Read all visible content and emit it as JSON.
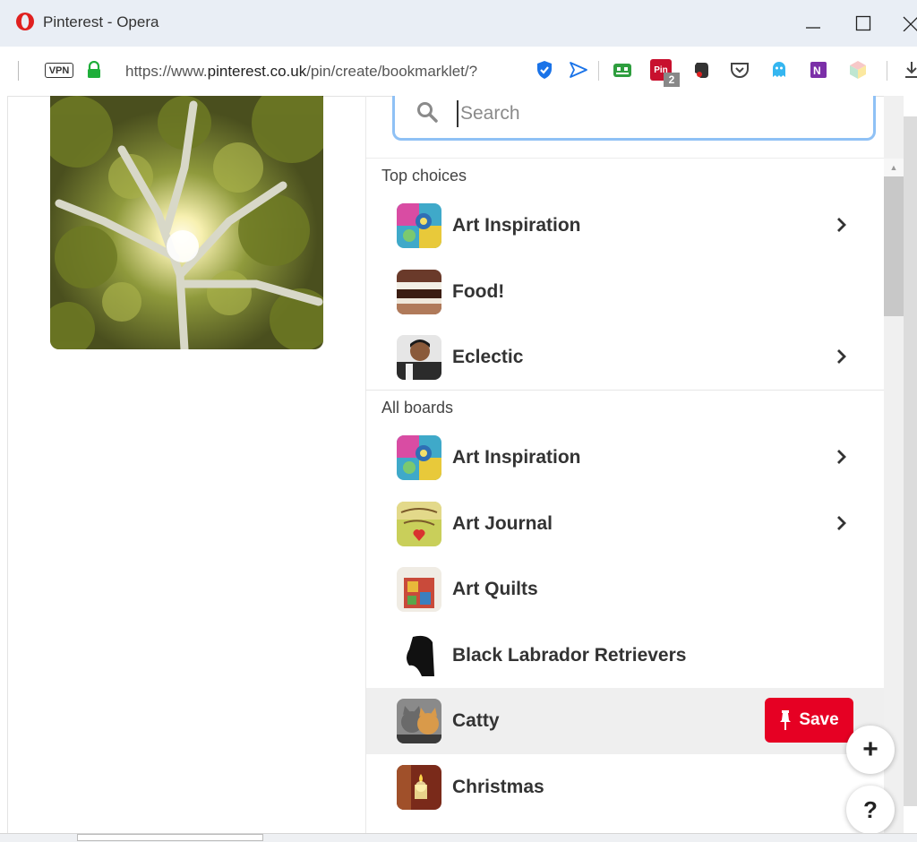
{
  "browser": {
    "title": "Pinterest - Opera",
    "vpn_label": "VPN",
    "url_prefix": "https://www.",
    "url_host": "pinterest.co.uk",
    "url_path": "/pin/create/bookmarklet/?",
    "extension_badge": "2",
    "extension_pin_label": "Pin",
    "window_buttons": {
      "minimize": "—",
      "maximize": "☐",
      "close": "✕"
    }
  },
  "search": {
    "placeholder": "Search",
    "value": ""
  },
  "sections": {
    "top_label": "Top choices",
    "all_label": "All boards"
  },
  "top_choices": [
    {
      "label": "Art Inspiration",
      "has_submenu": true
    },
    {
      "label": "Food!",
      "has_submenu": false
    },
    {
      "label": "Eclectic",
      "has_submenu": true
    }
  ],
  "all_boards": [
    {
      "label": "Art Inspiration",
      "has_submenu": true
    },
    {
      "label": "Art Journal",
      "has_submenu": true
    },
    {
      "label": "Art Quilts",
      "has_submenu": false
    },
    {
      "label": "Black Labrador Retrievers",
      "has_submenu": false
    },
    {
      "label": "Catty",
      "has_submenu": false,
      "hovered": true
    },
    {
      "label": "Christmas",
      "has_submenu": false
    }
  ],
  "save_button": {
    "label": "Save"
  },
  "fab": {
    "add": "+",
    "help": "?"
  },
  "colors": {
    "pinterest_red": "#e60023",
    "search_border": "#8fc1f5",
    "hover_row": "#efefef"
  }
}
